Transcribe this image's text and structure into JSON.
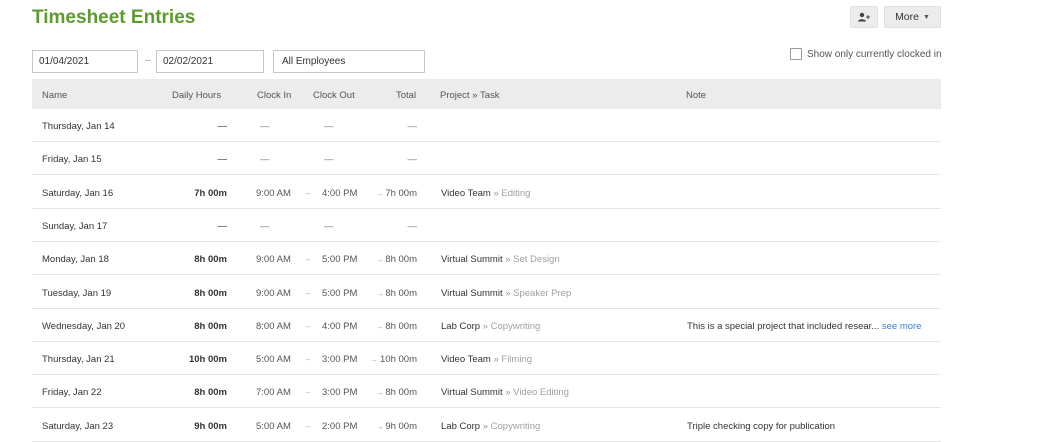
{
  "header": {
    "title": "Timesheet Entries",
    "add_icon_name": "person-add-icon",
    "more_label": "More",
    "more_icon_name": "caret-down-icon"
  },
  "filters": {
    "start_date": "01/04/2021",
    "separator": "–",
    "end_date": "02/02/2021",
    "employees": "All Employees",
    "clocked_in_label": "Show only currently clocked in",
    "clocked_in_checked": false
  },
  "table": {
    "columns": {
      "name": "Name",
      "daily": "Daily Hours",
      "clock_in": "Clock In",
      "clock_out": "Clock Out",
      "total": "Total",
      "project": "Project » Task",
      "note": "Note"
    },
    "rows": [
      {
        "name": "Thursday, Jan 14",
        "daily": "—",
        "clock_in": "—",
        "sep": "",
        "clock_out": "—",
        "arrow": "",
        "total": "—",
        "project": "",
        "task_sep": "",
        "task": "",
        "note": "",
        "note_link": ""
      },
      {
        "name": "Friday, Jan 15",
        "daily": "—",
        "clock_in": "—",
        "sep": "",
        "clock_out": "—",
        "arrow": "",
        "total": "—",
        "project": "",
        "task_sep": "",
        "task": "",
        "note": "",
        "note_link": ""
      },
      {
        "name": "Saturday, Jan 16",
        "daily": "7h 00m",
        "clock_in": "9:00 AM",
        "sep": "–",
        "clock_out": "4:00 PM",
        "arrow": "→",
        "total": "7h 00m",
        "project": "Video Team",
        "task_sep": " » ",
        "task": "Editing",
        "note": "",
        "note_link": ""
      },
      {
        "name": "Sunday, Jan 17",
        "daily": "—",
        "clock_in": "—",
        "sep": "",
        "clock_out": "—",
        "arrow": "",
        "total": "—",
        "project": "",
        "task_sep": "",
        "task": "",
        "note": "",
        "note_link": ""
      },
      {
        "name": "Monday, Jan 18",
        "daily": "8h 00m",
        "clock_in": "9:00 AM",
        "sep": "–",
        "clock_out": "5:00 PM",
        "arrow": "→",
        "total": "8h 00m",
        "project": "Virtual Summit",
        "task_sep": " » ",
        "task": "Set Design",
        "note": "",
        "note_link": ""
      },
      {
        "name": "Tuesday, Jan 19",
        "daily": "8h 00m",
        "clock_in": "9:00 AM",
        "sep": "–",
        "clock_out": "5:00 PM",
        "arrow": "→",
        "total": "8h 00m",
        "project": "Virtual Summit",
        "task_sep": " » ",
        "task": "Speaker Prep",
        "note": "",
        "note_link": ""
      },
      {
        "name": "Wednesday, Jan 20",
        "daily": "8h 00m",
        "clock_in": "8:00 AM",
        "sep": "–",
        "clock_out": "4:00 PM",
        "arrow": "→",
        "total": "8h 00m",
        "project": "Lab Corp",
        "task_sep": " » ",
        "task": "Copywriting",
        "note": "This is a special project that included resear... ",
        "note_link": "see more"
      },
      {
        "name": "Thursday, Jan 21",
        "daily": "10h 00m",
        "clock_in": "5:00 AM",
        "sep": "–",
        "clock_out": "3:00 PM",
        "arrow": "→",
        "total": "10h 00m",
        "project": "Video Team",
        "task_sep": " » ",
        "task": "Filming",
        "note": "",
        "note_link": ""
      },
      {
        "name": "Friday, Jan 22",
        "daily": "8h 00m",
        "clock_in": "7:00 AM",
        "sep": "–",
        "clock_out": "3:00 PM",
        "arrow": "→",
        "total": "8h 00m",
        "project": "Virtual Summit",
        "task_sep": " » ",
        "task": "Video Editing",
        "note": "",
        "note_link": ""
      },
      {
        "name": "Saturday, Jan 23",
        "daily": "9h 00m",
        "clock_in": "5:00 AM",
        "sep": "–",
        "clock_out": "2:00 PM",
        "arrow": "→",
        "total": "9h 00m",
        "project": "Lab Corp",
        "task_sep": " » ",
        "task": "Copywriting",
        "note": "Triple checking copy for publication",
        "note_link": ""
      }
    ]
  }
}
